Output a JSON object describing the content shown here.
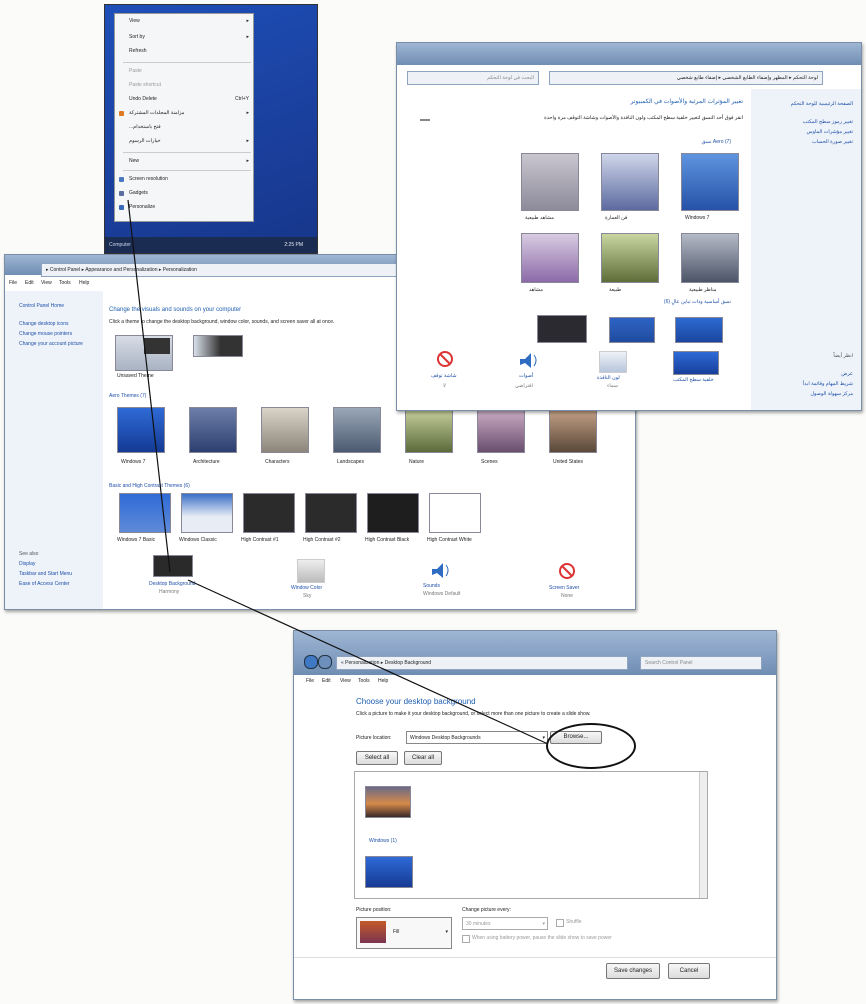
{
  "context_menu": {
    "items": [
      "View",
      "Sort by",
      "Refresh",
      "Paste",
      "Paste shortcut",
      "Undo Delete",
      "مزامنة المجلدات المشتركة",
      "...فتح باستخدام",
      "خيارات الرسوم",
      "New",
      "Screen resolution",
      "Gadgets",
      "Personalize"
    ],
    "undo_shortcut": "Ctrl+Y",
    "taskbar_label": "Computer",
    "clock": "2:25 PM"
  },
  "personalization": {
    "address": "▸ Control Panel ▸ Appearance and Personalization ▸ Personalization",
    "menu": [
      "File",
      "Edit",
      "View",
      "Tools",
      "Help"
    ],
    "sidebar_links": [
      "Control Panel Home",
      "Change desktop icons",
      "Change mouse pointers",
      "Change your account picture"
    ],
    "see_also": [
      "See also",
      "Display",
      "Taskbar and Start Menu",
      "Ease of Access Center"
    ],
    "title": "Change the visuals and sounds on your computer",
    "subtitle": "Click a theme to change the desktop background, window color, sounds, and screen saver all at once.",
    "my_themes_label": "Unsaved Theme",
    "aero_section": "Aero Themes (7)",
    "aero_themes": [
      "Windows 7",
      "Architecture",
      "Characters",
      "Landscapes",
      "Nature",
      "Scenes",
      "United States"
    ],
    "basic_section": "Basic and High Contrast Themes (6)",
    "basic_themes": [
      "Windows 7 Basic",
      "Windows Classic",
      "High Contrast #1",
      "High Contrast #2",
      "High Contrast Black",
      "High Contrast White"
    ],
    "bottom_links": [
      "Desktop Background",
      "Window Color",
      "Sounds",
      "Screen Saver"
    ],
    "bottom_sub": [
      "Harmony",
      "Sky",
      "Windows Default",
      "None"
    ]
  },
  "arabic_window": {
    "address": "لوحة التحكم ▸ المظهر وإضفاء الطابع الشخصي ▸ إضفاء طابع شخصي",
    "search_placeholder": "البحث في لوحة التحكم",
    "title": "تغيير المؤثرات المرئية والأصوات في الكمبيوتر",
    "subtitle": "انقر فوق أحد النسق لتغيير خلفية سطح المكتب ولون النافذة والأصوات وشاشة التوقف مرة واحدة",
    "sidebar_links": [
      "الصفحة الرئيسية للوحة التحكم",
      "تغيير رموز سطح المكتب",
      "تغيير مؤشرات الماوس",
      "تغيير صورة الحساب"
    ],
    "see_also": [
      "انظر أيضاً",
      "عرض",
      "شريط المهام وقائمة ابدأ",
      "مركز سهولة الوصول"
    ],
    "aero_section": "نسق Aero (7)",
    "basic_section": "نسق أساسية وذات تباين عالٍ (6)",
    "themes_row1": [
      "مشاهد طبيعية",
      "فن العمارة",
      "Windows 7"
    ],
    "themes_row2": [
      "مشاهد",
      "طبيعة",
      "مناظر طبيعية"
    ],
    "bottom_links": [
      "شاشة توقف",
      "أصوات",
      "لون النافذة",
      "خلفية سطح المكتب"
    ],
    "bottom_sub": [
      "لا",
      "افتراضي",
      "سماء",
      ""
    ]
  },
  "desktop_background": {
    "address": "« Personalization ▸ Desktop Background",
    "search_placeholder": "Search Control Panel",
    "menu": [
      "File",
      "Edit",
      "View",
      "Tools",
      "Help"
    ],
    "title": "Choose your desktop background",
    "subtitle": "Click a picture to make it your desktop background, or select more than one picture to create a slide show.",
    "location_label": "Picture location:",
    "location_value": "Windows Desktop Backgrounds",
    "browse_label": "Browse...",
    "select_all": "Select all",
    "clear_all": "Clear all",
    "group_label": "Windows (1)",
    "position_label": "Picture position:",
    "position_value": "Fill",
    "change_every_label": "Change picture every:",
    "interval_value": "30 minutes",
    "shuffle_label": "Shuffle",
    "battery_label": "When using battery power, pause the slide show to save power",
    "save_label": "Save changes",
    "cancel_label": "Cancel"
  }
}
